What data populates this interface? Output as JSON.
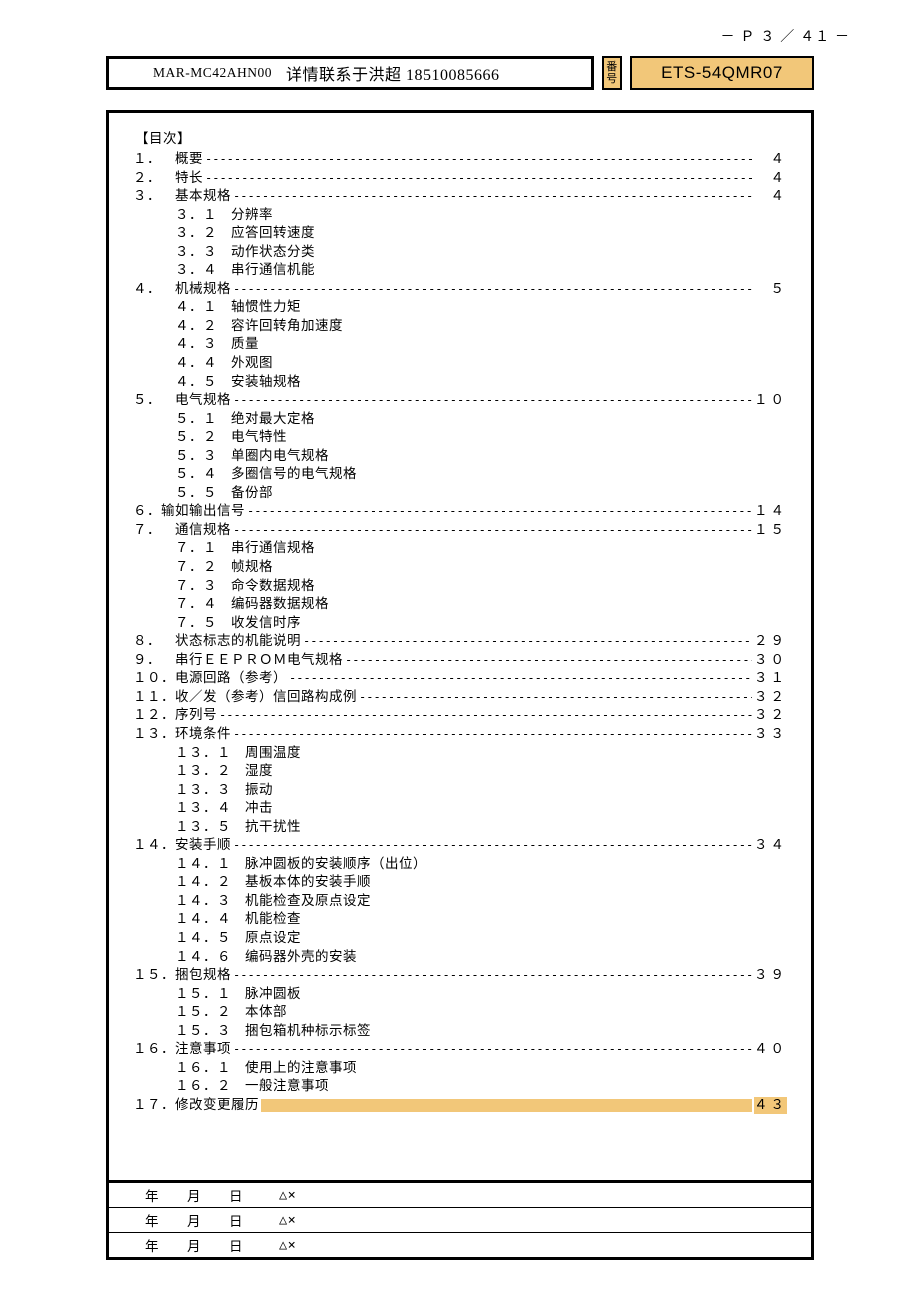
{
  "page_number_header": "－ Ｐ ３ ／ ４１ －",
  "header": {
    "model": "MAR-MC42AHN00",
    "contact": "详情联系于洪超 18510085666",
    "bango_label_1": "番",
    "bango_label_2": "号",
    "doc_no": "ETS-54QMR07"
  },
  "toc_title": "【目次】",
  "sections": [
    {
      "num": "１．",
      "title": "　概要",
      "page": "４",
      "subs": []
    },
    {
      "num": "２．",
      "title": "　特长",
      "page": "４",
      "subs": []
    },
    {
      "num": "３．",
      "title": "　基本规格",
      "page": "４",
      "subs": [
        {
          "n": "３．１",
          "t": "分辨率"
        },
        {
          "n": "３．２",
          "t": "应答回转速度"
        },
        {
          "n": "３．３",
          "t": "动作状态分类"
        },
        {
          "n": "３．４",
          "t": "串行通信机能"
        }
      ]
    },
    {
      "num": "４．",
      "title": "　机械规格",
      "page": "５",
      "subs": [
        {
          "n": "４．１",
          "t": "轴惯性力矩"
        },
        {
          "n": "４．２",
          "t": "容许回转角加速度"
        },
        {
          "n": "４．３",
          "t": "质量"
        },
        {
          "n": "４．４",
          "t": "外观图"
        },
        {
          "n": "４．５",
          "t": "安装轴规格"
        }
      ]
    },
    {
      "num": "５．",
      "title": "　电气规格",
      "page": "１０",
      "subs": [
        {
          "n": "５．１",
          "t": "绝对最大定格"
        },
        {
          "n": "５．２",
          "t": "电气特性"
        },
        {
          "n": "５．３",
          "t": "单圈内电气规格"
        },
        {
          "n": "５．４",
          "t": "多圈信号的电气规格"
        },
        {
          "n": "５．５",
          "t": "备份部"
        }
      ]
    },
    {
      "num": "６．",
      "title": "输如输出信号",
      "page": "１４",
      "subs": []
    },
    {
      "num": "７．",
      "title": "　通信规格",
      "page": "１５",
      "subs": [
        {
          "n": "７．１",
          "t": "串行通信规格"
        },
        {
          "n": "７．２",
          "t": "帧规格"
        },
        {
          "n": "７．３",
          "t": "命令数据规格"
        },
        {
          "n": "７．４",
          "t": "编码器数据规格"
        },
        {
          "n": "７．５",
          "t": "收发信时序"
        }
      ]
    },
    {
      "num": "８．",
      "title": "　状态标志的机能说明",
      "page": "２９",
      "subs": []
    },
    {
      "num": "９．",
      "title": "　串行ＥＥＰＲＯＭ电气规格",
      "page": "３０",
      "subs": []
    },
    {
      "num": "１０．",
      "title": "电源回路（参考）",
      "page": "３１",
      "subs": []
    },
    {
      "num": "１１．",
      "title": "收／发（参考）信回路构成例",
      "page": "３２",
      "subs": []
    },
    {
      "num": "１２．",
      "title": "序列号",
      "page": "３２",
      "subs": []
    },
    {
      "num": "１３．",
      "title": "环境条件",
      "page": "３３",
      "subs": [
        {
          "n": "１３．１",
          "t": "周围温度"
        },
        {
          "n": "１３．２",
          "t": "湿度"
        },
        {
          "n": "１３．３",
          "t": "振动"
        },
        {
          "n": "１３．４",
          "t": "冲击"
        },
        {
          "n": "１３．５",
          "t": "抗干扰性"
        }
      ]
    },
    {
      "num": "１４．",
      "title": "安装手顺",
      "page": "３４",
      "subs": [
        {
          "n": "１４．１",
          "t": "脉冲圆板的安装顺序（出位）"
        },
        {
          "n": "１４．２",
          "t": "基板本体的安装手顺"
        },
        {
          "n": "１４．３",
          "t": "机能检查及原点设定"
        },
        {
          "n": "１４．４",
          "t": "机能检查"
        },
        {
          "n": "１４．５",
          "t": "原点设定"
        },
        {
          "n": "１４．６",
          "t": "编码器外壳的安装"
        }
      ]
    },
    {
      "num": "１５．",
      "title": "捆包规格",
      "page": "３９",
      "subs": [
        {
          "n": "１５．１",
          "t": "脉冲圆板"
        },
        {
          "n": "１５．２",
          "t": "本体部"
        },
        {
          "n": "１５．３",
          "t": "捆包箱机种标示标签"
        }
      ]
    },
    {
      "num": "１６．",
      "title": "注意事项",
      "page": "４０",
      "subs": [
        {
          "n": "１６．１",
          "t": "使用上的注意事项"
        },
        {
          "n": "１６．２",
          "t": "一般注意事项"
        }
      ]
    },
    {
      "num": "１７．",
      "title": "修改变更履历",
      "page": "４３",
      "subs": [],
      "highlight": true
    }
  ],
  "approval_row": {
    "date_label": "年　　月　　日",
    "mark": "△×"
  }
}
